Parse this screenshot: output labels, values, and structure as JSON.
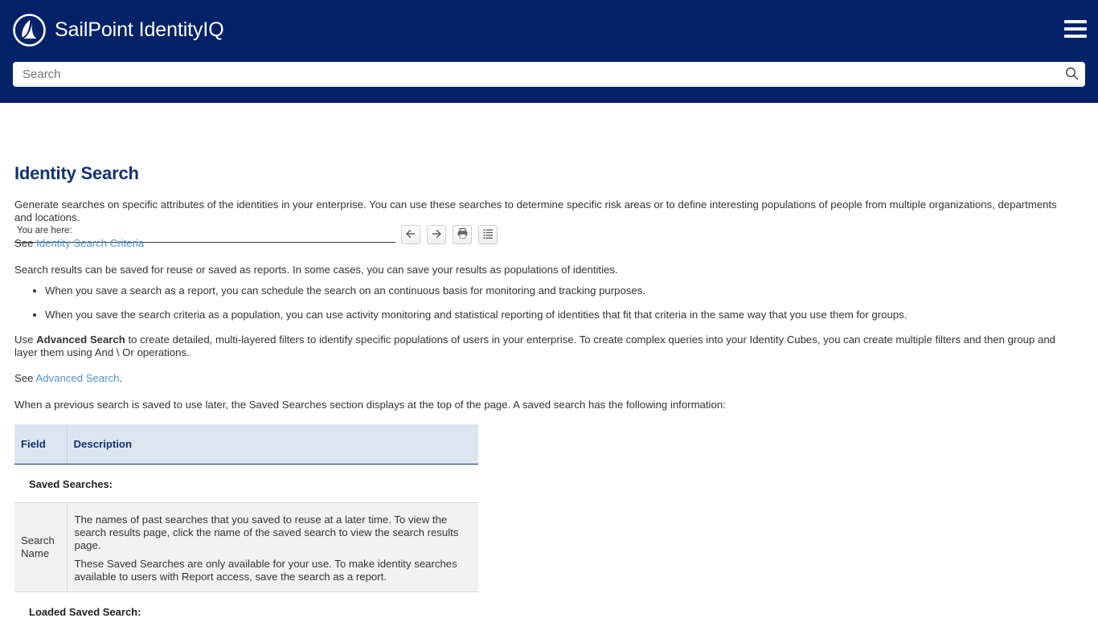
{
  "header": {
    "brand_title": "SailPoint IdentityIQ",
    "logo_icon": "sailboat-logo-icon",
    "menu_icon": "hamburger-menu-icon",
    "brand_color": "#042268"
  },
  "search": {
    "placeholder": "Search",
    "value": "",
    "icon": "search-magnifier-icon"
  },
  "breadcrumb": {
    "label": "You are here:",
    "trail": ""
  },
  "toolbar": {
    "buttons": [
      {
        "name": "back-button",
        "icon": "arrow-left-icon",
        "title": "Previous"
      },
      {
        "name": "forward-button",
        "icon": "arrow-right-icon",
        "title": "Next"
      },
      {
        "name": "print-button",
        "icon": "printer-icon",
        "title": "Print"
      },
      {
        "name": "toc-button",
        "icon": "list-icon",
        "title": "Contents"
      }
    ]
  },
  "main": {
    "title": "Identity Search",
    "intro": "Generate searches on specific attributes of the identities in your enterprise. You can use these searches to determine specific risk areas or to define interesting populations of people from multiple organizations, departments and locations.",
    "see_prefix_1": "See ",
    "link_1": "Identity Search Criteria",
    "saved_para": "Search results can be saved for reuse or saved as reports. In some cases, you can save your results as populations of identities.",
    "bullets": [
      "When you save a search as a report, you can schedule the search on an continuous basis for monitoring and tracking purposes.",
      "When you save the search criteria as a population, you can use activity monitoring and statistical reporting of identities that fit that criteria in the same way that you use them for groups."
    ],
    "advanced_pre": "Use ",
    "advanced_bold": "Advanced Search",
    "advanced_post": " to create detailed, multi-layered filters to identify specific populations of users in your enterprise. To create complex queries into your Identity Cubes, you can create multiple filters and then group and layer them using And \\ Or operations.",
    "see_prefix_2": "See ",
    "link_2": "Advanced Search",
    "see_suffix_2": ".",
    "saved_searches_para": "When a previous search is saved to use later, the Saved Searches section displays at the top of the page. A saved search has the following information:"
  },
  "table": {
    "headers": {
      "field": "Field",
      "description": "Description"
    },
    "section_1": "Saved Searches:",
    "rows": [
      {
        "field": "Search Name",
        "desc_1": "The names of past searches that you saved to reuse at a later time. To view the search results page, click the name of the saved search to view the search results page.",
        "desc_2": "These Saved Searches are only available for your use. To make identity searches available to users with Report access, save the search as a report."
      }
    ],
    "section_2": "Loaded Saved Search:"
  }
}
